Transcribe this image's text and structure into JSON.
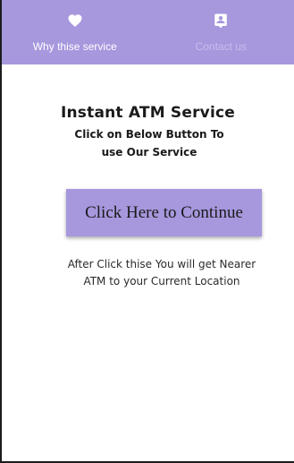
{
  "colors": {
    "accent": "#a797dd",
    "tab_active_text": "#ffffff",
    "tab_inactive_text": "#c8bdec"
  },
  "nav": {
    "tabs": [
      {
        "label": "Why thise service",
        "icon": "heart-icon",
        "active": true
      },
      {
        "label": "Contact us",
        "icon": "contact-icon",
        "active": false
      }
    ]
  },
  "main": {
    "title": "Instant ATM Service",
    "subtitle": "Click on Below Button To use Our Service",
    "button_label": "Click Here to Continue",
    "description": "After Click thise You will get Nearer ATM to your Current Location"
  }
}
